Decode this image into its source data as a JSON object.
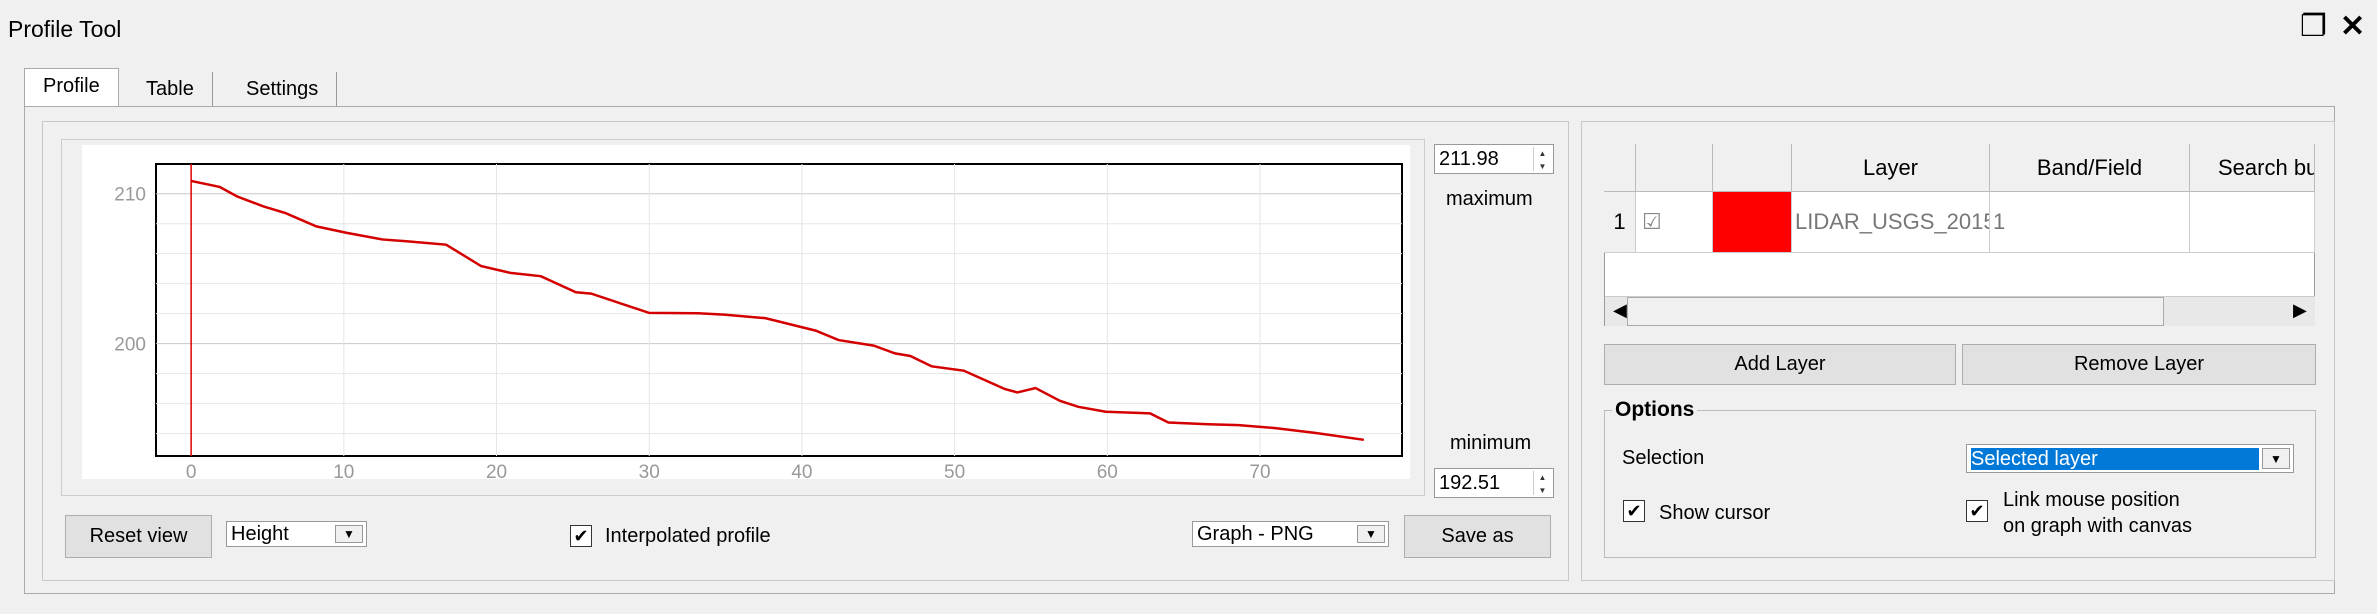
{
  "window": {
    "title": "Profile Tool",
    "restore_icon": "restore-icon",
    "close_icon": "close-icon"
  },
  "tabs": [
    {
      "label": "Profile",
      "active": true
    },
    {
      "label": "Table"
    },
    {
      "label": "Settings"
    }
  ],
  "profile": {
    "max_value": "211.98",
    "max_label": "maximum",
    "min_value": "192.51",
    "min_label": "minimum",
    "reset_view": "Reset view",
    "plot_type": "Height",
    "interpolated_label": "Interpolated profile",
    "interpolated_checked": true,
    "export_format": "Graph - PNG",
    "save_as": "Save as"
  },
  "chart_data": {
    "type": "line",
    "title": "",
    "xlabel": "",
    "ylabel": "",
    "xlim": [
      -2.3,
      79.3
    ],
    "ylim": [
      192.51,
      211.98
    ],
    "xticks": [
      0,
      10,
      20,
      30,
      40,
      50,
      60,
      70
    ],
    "yticks": [
      200,
      210
    ],
    "grid": true,
    "line_color": "#d40000",
    "cursor_x": 0,
    "series": [
      {
        "x": [
          0,
          1.87,
          3.0,
          4.74,
          6.2,
          8.2,
          10.2,
          12.5,
          14.2,
          16.7,
          19.0,
          20.9,
          22.9,
          25.2,
          26.2,
          30.0,
          33.2,
          34.9,
          37.6,
          40.9,
          42.4,
          44.7,
          46.1,
          47.1,
          48.5,
          50.6,
          53.3,
          54.1,
          55.3,
          56.9,
          58.1,
          59.9,
          62.8,
          64.0,
          66.6,
          68.6,
          71.0,
          73.6,
          76.8
        ],
        "y": [
          210.85,
          210.45,
          209.82,
          209.15,
          208.7,
          207.82,
          207.39,
          206.95,
          206.82,
          206.6,
          205.17,
          204.72,
          204.5,
          203.43,
          203.34,
          202.05,
          202.03,
          201.94,
          201.7,
          200.87,
          200.24,
          199.87,
          199.35,
          199.18,
          198.49,
          198.2,
          196.97,
          196.75,
          197.04,
          196.19,
          195.79,
          195.46,
          195.35,
          194.74,
          194.63,
          194.57,
          194.37,
          194.05,
          193.59
        ]
      }
    ]
  },
  "layers": {
    "headers": [
      "",
      "",
      "",
      "Layer",
      "Band/Field",
      "Search bu"
    ],
    "rows": [
      {
        "num": "1",
        "color": "#ff0000",
        "layer": "LIDAR_USGS_2015",
        "band": "1",
        "search": ""
      }
    ],
    "add": "Add Layer",
    "remove": "Remove Layer"
  },
  "options": {
    "title": "Options",
    "selection_label": "Selection",
    "selection_value": "Selected layer",
    "selection_bg": "#0078d7",
    "show_cursor": "Show cursor",
    "show_cursor_checked": true,
    "link_line1": "Link mouse position",
    "link_line2": "on graph with canvas",
    "link_checked": true
  }
}
